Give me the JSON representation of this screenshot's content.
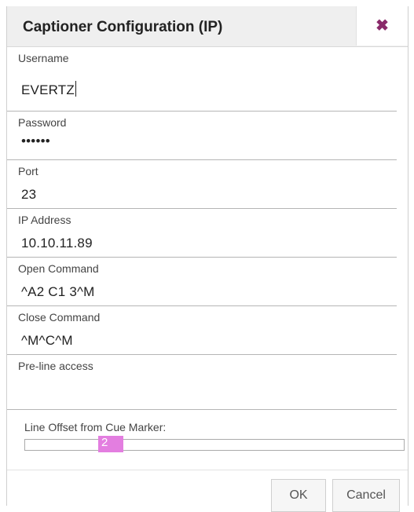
{
  "dialog": {
    "title": "Captioner Configuration (IP)",
    "close_icon": "close-icon"
  },
  "fields": {
    "username": {
      "label": "Username",
      "value": "EVERTZ"
    },
    "password": {
      "label": "Password",
      "value": "••••••"
    },
    "port": {
      "label": "Port",
      "value": "23"
    },
    "ip_address": {
      "label": "IP Address",
      "value": "10.10.11.89"
    },
    "open_command": {
      "label": "Open Command",
      "value": "^A2 C1 3^M"
    },
    "close_command": {
      "label": "Close Command",
      "value": "^M^C^M"
    },
    "pre_line_access": {
      "label": "Pre-line access",
      "value": ""
    }
  },
  "line_offset": {
    "label": "Line Offset from Cue Marker:",
    "value": "2"
  },
  "buttons": {
    "ok": "OK",
    "cancel": "Cancel"
  },
  "colors": {
    "accent": "#e37ee0",
    "close_icon": "#8a2a6a"
  }
}
